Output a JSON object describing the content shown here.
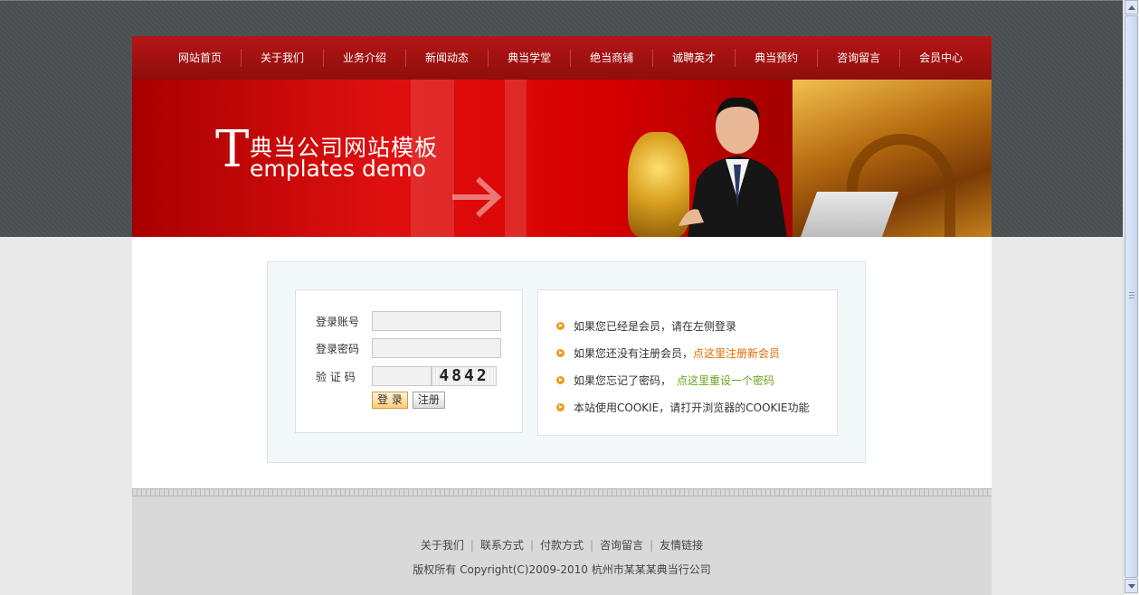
{
  "nav": {
    "items": [
      "网站首页",
      "关于我们",
      "业务介绍",
      "新闻动态",
      "典当学堂",
      "绝当商铺",
      "诚聘英才",
      "典当预约",
      "咨询留言",
      "会员中心"
    ]
  },
  "banner": {
    "big_letter": "T",
    "title_cn": "典当公司网站模板",
    "title_en": "emplates demo"
  },
  "login": {
    "account_label": "登录账号",
    "account_value": "",
    "password_label": "登录密码",
    "password_value": "",
    "captcha_label": "验 证 码",
    "captcha_value": "",
    "captcha_code": "4842",
    "login_button": "登 录",
    "register_button": "注册"
  },
  "info": {
    "line1": "如果您已经是会员，请在左侧登录",
    "line2_text": "如果您还没有注册会员，",
    "line2_link": "点这里注册新会员",
    "line3_text": "如果您忘记了密码，",
    "line3_link": "点这里重设一个密码",
    "line4": "本站使用COOKIE，请打开浏览器的COOKIE功能"
  },
  "footer": {
    "links": [
      "关于我们",
      "联系方式",
      "付款方式",
      "咨询留言",
      "友情链接"
    ],
    "separator": "|",
    "copyright": "版权所有  Copyright(C)2009-2010 杭州市某某某典当行公司"
  },
  "colors": {
    "nav_bg": "#a31212",
    "accent_orange": "#e66a00",
    "accent_green": "#6aa51a"
  }
}
